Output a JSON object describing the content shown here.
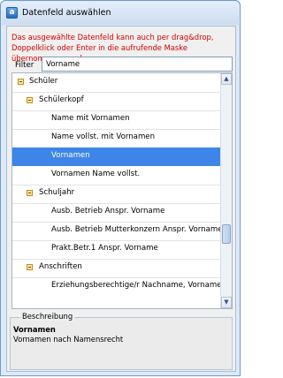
{
  "window": {
    "title": "Datenfeld auswählen",
    "icon_letter": "a"
  },
  "info_text": "Das ausgewählte Datenfeld kann auch per drag&drop, Doppelklick oder Enter in die aufrufende Maske übernommen werden.",
  "filter": {
    "label": "Filter",
    "value": "Vorname"
  },
  "tree": {
    "rows": [
      {
        "label": "Schüler",
        "level": 0,
        "expandable": true,
        "selected": false
      },
      {
        "label": "Schülerkopf",
        "level": 1,
        "expandable": true,
        "selected": false
      },
      {
        "label": "Name mit Vornamen",
        "level": 2,
        "expandable": false,
        "selected": false
      },
      {
        "label": "Name vollst. mit Vornamen",
        "level": 2,
        "expandable": false,
        "selected": false
      },
      {
        "label": "Vornamen",
        "level": 2,
        "expandable": false,
        "selected": true
      },
      {
        "label": "Vornamen Name vollst.",
        "level": 2,
        "expandable": false,
        "selected": false
      },
      {
        "label": "Schuljahr",
        "level": 1,
        "expandable": true,
        "selected": false
      },
      {
        "label": "Ausb. Betrieb Anspr. Vorname",
        "level": 2,
        "expandable": false,
        "selected": false
      },
      {
        "label": "Ausb. Betrieb  Mutterkonzern Anspr. Vorname",
        "level": 2,
        "expandable": false,
        "selected": false
      },
      {
        "label": "Prakt.Betr.1 Anspr. Vorname",
        "level": 2,
        "expandable": false,
        "selected": false
      },
      {
        "label": "Anschriften",
        "level": 1,
        "expandable": true,
        "selected": false
      },
      {
        "label": "Erziehungsberechtige/r Nachname, Vorname",
        "level": 2,
        "expandable": false,
        "selected": false
      }
    ]
  },
  "description": {
    "legend": "Beschreibung",
    "title": "Vornamen",
    "text": "Vornamen nach Namensrecht"
  },
  "colors": {
    "selection": "#3d86e8",
    "info_text": "#d40000"
  }
}
